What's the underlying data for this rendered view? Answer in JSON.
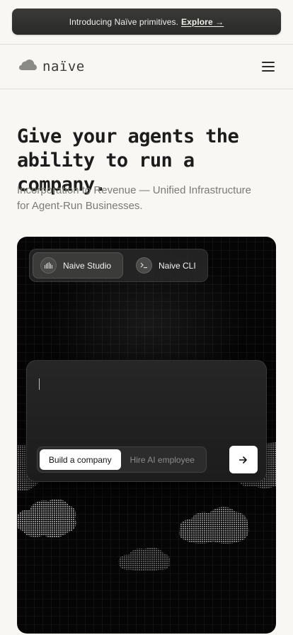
{
  "announcement": {
    "text": "Introducing Naïve primitives.",
    "link_label": "Explore →"
  },
  "header": {
    "logo_text": "naïve",
    "menu_icon": "hamburger-icon"
  },
  "hero": {
    "title_line1": "Give your agents the",
    "title_line2": "ability to run a company.",
    "subtitle_line1": "Incorporation to Revenue — Unified Infrastructure",
    "subtitle_line2": "for Agent-Run Businesses."
  },
  "demo": {
    "tabs": [
      {
        "label": "Naive Studio",
        "icon": "studio-icon",
        "active": true
      },
      {
        "label": "Naive CLI",
        "icon": "terminal-icon",
        "active": false
      }
    ],
    "prompt": {
      "options": [
        {
          "label": "Build a company",
          "active": true
        },
        {
          "label": "Hire AI employee",
          "active": false
        }
      ],
      "send_icon": "arrow-right-icon"
    }
  },
  "colors": {
    "background": "#f8f7f3",
    "announce_bg": "#2f2f2e",
    "demo_bg": "#050505",
    "text_primary": "#1c1c1c",
    "text_muted": "#7a7a76"
  }
}
